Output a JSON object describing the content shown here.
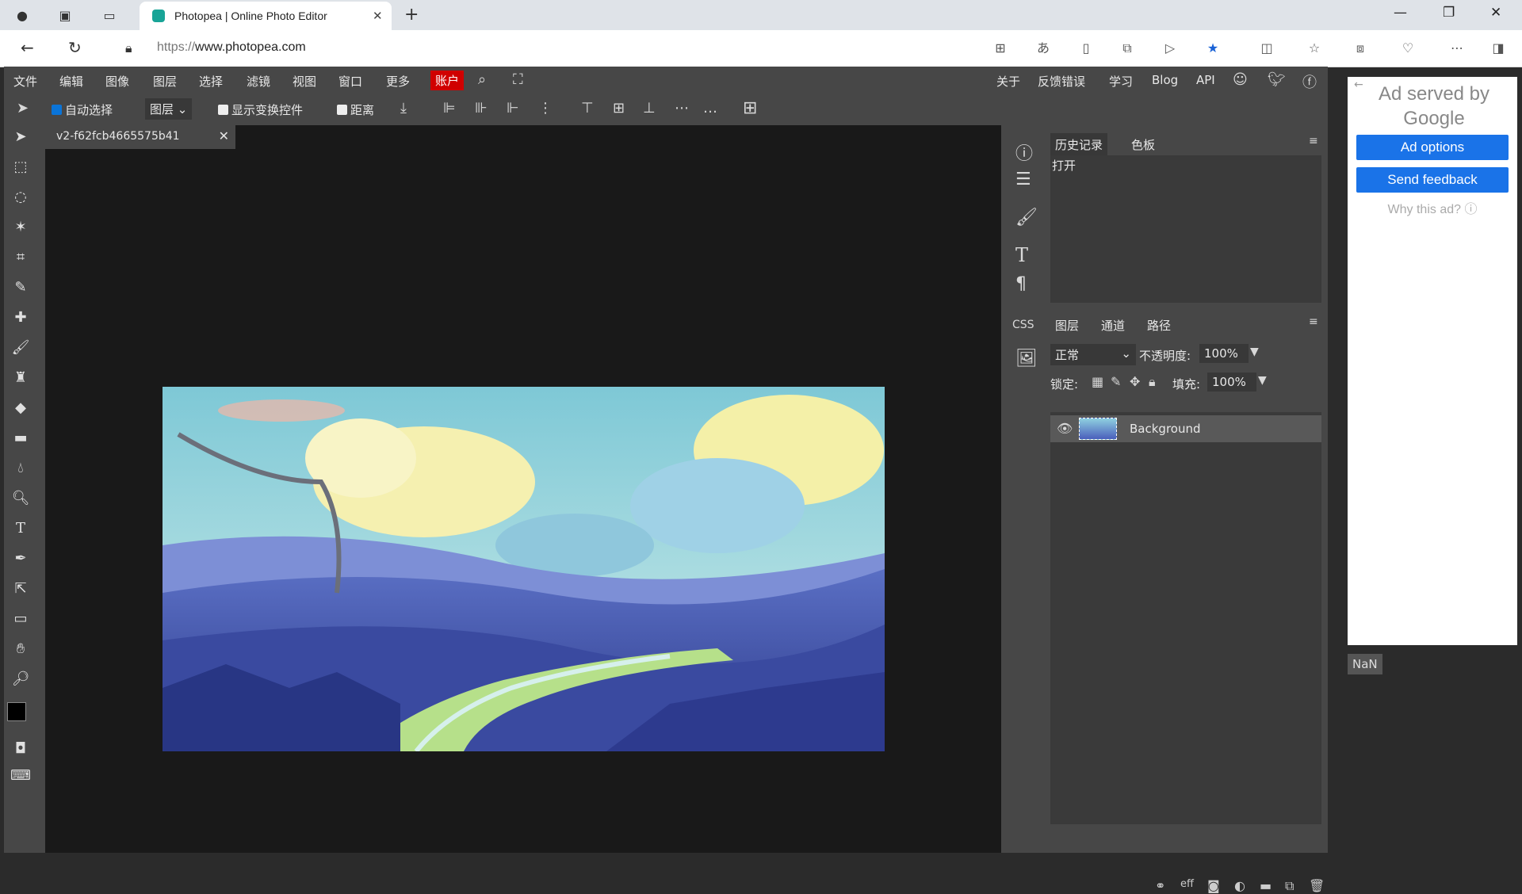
{
  "browser": {
    "tab_title": "Photopea | Online Photo Editor",
    "url_proto": "https://",
    "url_host": "www.photopea.com"
  },
  "menubar": {
    "items": [
      "文件",
      "编辑",
      "图像",
      "图层",
      "选择",
      "滤镜",
      "视图",
      "窗口",
      "更多"
    ],
    "account": "账户",
    "right_links": [
      "关于",
      "反馈错误",
      "学习",
      "Blog",
      "API"
    ]
  },
  "options": {
    "auto_select": "自动选择",
    "layer_select": "图层",
    "show_transform": "显示变换控件",
    "distance": "距离"
  },
  "document": {
    "tab_name": "v2-f62fcb4665575b41"
  },
  "history_panel": {
    "tabs": [
      "历史记录",
      "色板"
    ],
    "entries": [
      "打开"
    ]
  },
  "layers_panel": {
    "tabs": [
      "图层",
      "通道",
      "路径"
    ],
    "blend_mode": "正常",
    "opacity_label": "不透明度:",
    "opacity_value": "100%",
    "lock_label": "锁定:",
    "fill_label": "填充:",
    "fill_value": "100%",
    "layers": [
      "Background"
    ]
  },
  "ad": {
    "heading": "Ad served by Google",
    "options_btn": "Ad options",
    "feedback_btn": "Send feedback",
    "why": "Why this ad? ⓘ"
  },
  "nan_label": "NaN",
  "colors": {
    "accent": "#1a73e8",
    "account_red": "#d00000",
    "app_bg": "#474747",
    "canvas_bg": "#191919"
  }
}
